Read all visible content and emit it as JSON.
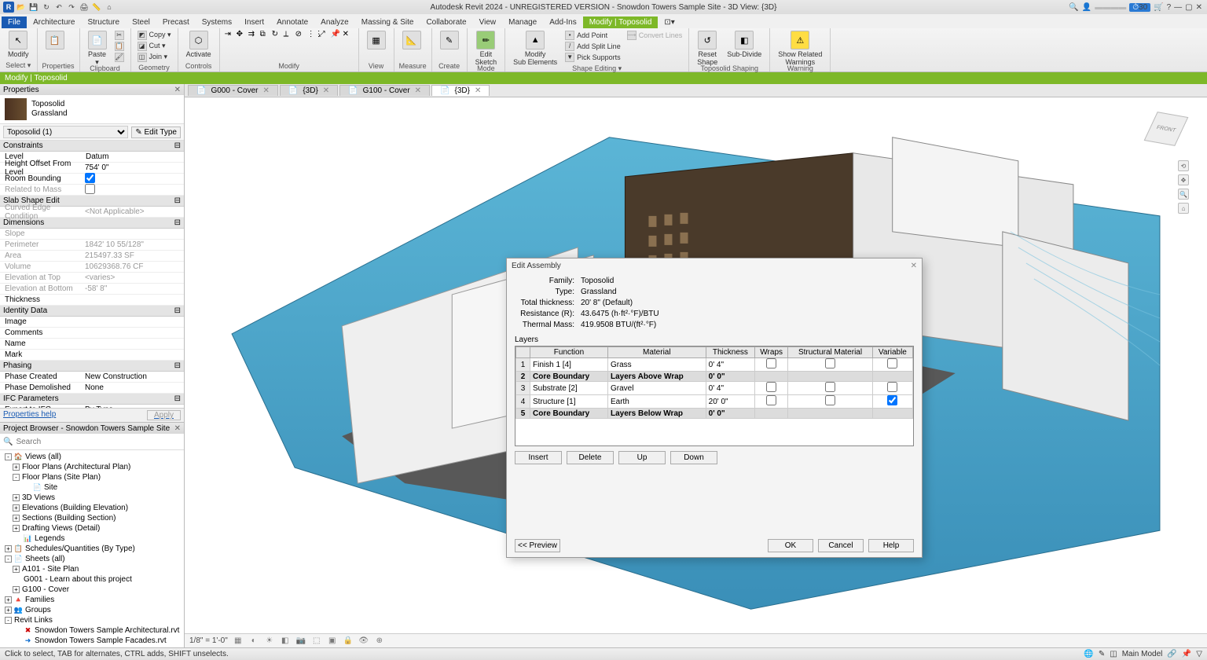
{
  "app": {
    "titlebar": "Autodesk Revit 2024 - UNREGISTERED VERSION - Snowdon Towers Sample Site - 3D View: {3D}",
    "logo_letter": "R"
  },
  "ribbon_tabs": [
    "File",
    "Architecture",
    "Structure",
    "Steel",
    "Precast",
    "Systems",
    "Insert",
    "Annotate",
    "Analyze",
    "Massing & Site",
    "Collaborate",
    "View",
    "Manage",
    "Add-Ins",
    "Modify | Toposolid"
  ],
  "ribbon": {
    "groups": {
      "select": "Select ▾",
      "properties": "Properties",
      "clipboard": "Clipboard",
      "geometry": "Geometry",
      "controls": "Controls",
      "modify": "Modify",
      "view": "View",
      "measure": "Measure",
      "create": "Create",
      "mode": "Mode",
      "shape_editing": "Shape Editing ▾",
      "toposolid_shaping": "Toposolid Shaping",
      "warning": "Warning"
    },
    "btns": {
      "modify_big": "Modify",
      "paste": "Paste\n▾",
      "activate": "Activate",
      "copy": "Copy ▾",
      "cut": "Cut ▾",
      "join": "Join ▾",
      "edit_sketch": "Edit\nSketch",
      "modify_sub": "Modify\nSub Elements",
      "add_point": "Add Point",
      "add_split_line": "Add Split Line",
      "pick_supports": "Pick Supports",
      "convert_lines": "Convert Lines",
      "reset_shape": "Reset\nShape",
      "sub_divide": "Sub-Divide",
      "show_warnings": "Show Related\nWarnings"
    }
  },
  "context_bar": "Modify | Toposolid",
  "view_tabs": [
    {
      "label": "G000 - Cover",
      "active": false
    },
    {
      "label": "{3D}",
      "active": false
    },
    {
      "label": "G100 - Cover",
      "active": false
    },
    {
      "label": "{3D}",
      "active": true
    }
  ],
  "properties": {
    "title": "Properties",
    "type_family": "Toposolid",
    "type_name": "Grassland",
    "instance_sel": "Toposolid (1)",
    "edit_type": "✎ Edit Type",
    "help": "Properties help",
    "apply": "Apply",
    "cats": [
      {
        "name": "Constraints",
        "rows": [
          {
            "n": "Level",
            "v": "Datum",
            "editable": true
          },
          {
            "n": "Height Offset From Level",
            "v": "754'  0\""
          },
          {
            "n": "Room Bounding",
            "v": "",
            "check": true
          },
          {
            "n": "Related to Mass",
            "v": "",
            "dim": true,
            "check": false
          }
        ]
      },
      {
        "name": "Slab Shape Edit",
        "rows": [
          {
            "n": "Curved Edge Condition",
            "v": "<Not Applicable>",
            "dim": true
          }
        ]
      },
      {
        "name": "Dimensions",
        "rows": [
          {
            "n": "Slope",
            "v": "",
            "dim": true
          },
          {
            "n": "Perimeter",
            "v": "1842'  10 55/128\"",
            "dim": true
          },
          {
            "n": "Area",
            "v": "215497.33 SF",
            "dim": true
          },
          {
            "n": "Volume",
            "v": "10629368.76 CF",
            "dim": true
          },
          {
            "n": "Elevation at Top",
            "v": "<varies>",
            "dim": true
          },
          {
            "n": "Elevation at Bottom",
            "v": "-58'  8\"",
            "dim": true
          },
          {
            "n": "Thickness",
            "v": ""
          }
        ]
      },
      {
        "name": "Identity Data",
        "rows": [
          {
            "n": "Image",
            "v": ""
          },
          {
            "n": "Comments",
            "v": ""
          },
          {
            "n": "Name",
            "v": ""
          },
          {
            "n": "Mark",
            "v": ""
          }
        ]
      },
      {
        "name": "Phasing",
        "rows": [
          {
            "n": "Phase Created",
            "v": "New Construction"
          },
          {
            "n": "Phase Demolished",
            "v": "None"
          }
        ]
      },
      {
        "name": "IFC Parameters",
        "rows": [
          {
            "n": "Export to IFC",
            "v": "By Type"
          }
        ]
      }
    ]
  },
  "browser": {
    "title": "Project Browser - Snowdon Towers Sample Site",
    "search_placeholder": "Search",
    "tree": [
      {
        "l": 0,
        "exp": "-",
        "ic": "🏠",
        "t": "Views (all)"
      },
      {
        "l": 1,
        "exp": "+",
        "t": "Floor Plans (Architectural Plan)"
      },
      {
        "l": 1,
        "exp": "-",
        "t": "Floor Plans (Site Plan)"
      },
      {
        "l": 2,
        "ic": "📄",
        "t": "Site"
      },
      {
        "l": 1,
        "exp": "+",
        "t": "3D Views"
      },
      {
        "l": 1,
        "exp": "+",
        "t": "Elevations (Building Elevation)"
      },
      {
        "l": 1,
        "exp": "+",
        "t": "Sections (Building Section)"
      },
      {
        "l": 1,
        "exp": "+",
        "t": "Drafting Views (Detail)"
      },
      {
        "l": 1,
        "ic": "📊",
        "t": "Legends"
      },
      {
        "l": 0,
        "exp": "+",
        "ic": "📋",
        "t": "Schedules/Quantities (By Type)"
      },
      {
        "l": 0,
        "exp": "-",
        "ic": "📄",
        "t": "Sheets (all)"
      },
      {
        "l": 1,
        "exp": "+",
        "t": "A101 - Site Plan"
      },
      {
        "l": 1,
        "t": "G001 - Learn about this project"
      },
      {
        "l": 1,
        "exp": "+",
        "t": "G100 - Cover"
      },
      {
        "l": 0,
        "exp": "+",
        "ic": "🔺",
        "t": "Families"
      },
      {
        "l": 0,
        "exp": "+",
        "ic": "👥",
        "t": "Groups"
      },
      {
        "l": 0,
        "exp": "-",
        "t": "Revit Links"
      },
      {
        "l": 1,
        "ic": "✖",
        "ic_color": "#c00",
        "t": "Snowdon Towers Sample Architectural.rvt"
      },
      {
        "l": 1,
        "ic": "➜",
        "ic_color": "#06c",
        "t": "Snowdon Towers Sample Facades.rvt"
      }
    ]
  },
  "view_ctrl": {
    "scale": "1/8\" = 1'-0\""
  },
  "status": {
    "left": "Click to select, TAB for alternates, CTRL adds, SHIFT unselects.",
    "model_label": "Main Model"
  },
  "dialog": {
    "title": "Edit Assembly",
    "info": [
      {
        "k": "Family:",
        "v": "Toposolid"
      },
      {
        "k": "Type:",
        "v": "Grassland"
      },
      {
        "k": "Total thickness:",
        "v": "20'  8\" (Default)"
      },
      {
        "k": "Resistance (R):",
        "v": "43.6475 (h·ft²·°F)/BTU"
      },
      {
        "k": "Thermal Mass:",
        "v": "419.9508 BTU/(ft²·°F)"
      }
    ],
    "layers_label": "Layers",
    "columns": [
      "",
      "Function",
      "Material",
      "Thickness",
      "Wraps",
      "Structural Material",
      "Variable"
    ],
    "rows": [
      {
        "num": "1",
        "fn": "Finish 1 [4]",
        "mat": "Grass",
        "th": "0'  4\"",
        "wraps": false,
        "struct": false,
        "var": false,
        "cb": false
      },
      {
        "num": "2",
        "fn": "Core Boundary",
        "mat": "Layers Above Wrap",
        "th": "0'  0\"",
        "cb": true
      },
      {
        "num": "3",
        "fn": "Substrate [2]",
        "mat": "Gravel",
        "th": "0'  4\"",
        "wraps": false,
        "struct": false,
        "var": false,
        "cb": false
      },
      {
        "num": "4",
        "fn": "Structure [1]",
        "mat": "Earth",
        "th": "20'  0\"",
        "wraps": false,
        "struct": false,
        "var": true,
        "cb": false
      },
      {
        "num": "5",
        "fn": "Core Boundary",
        "mat": "Layers Below Wrap",
        "th": "0'  0\"",
        "cb": true
      }
    ],
    "btns": {
      "insert": "Insert",
      "delete": "Delete",
      "up": "Up",
      "down": "Down",
      "preview": "<< Preview",
      "ok": "OK",
      "cancel": "Cancel",
      "help": "Help"
    }
  },
  "topbar_right": {
    "trial": "30",
    "user": "▬▬▬▬"
  }
}
